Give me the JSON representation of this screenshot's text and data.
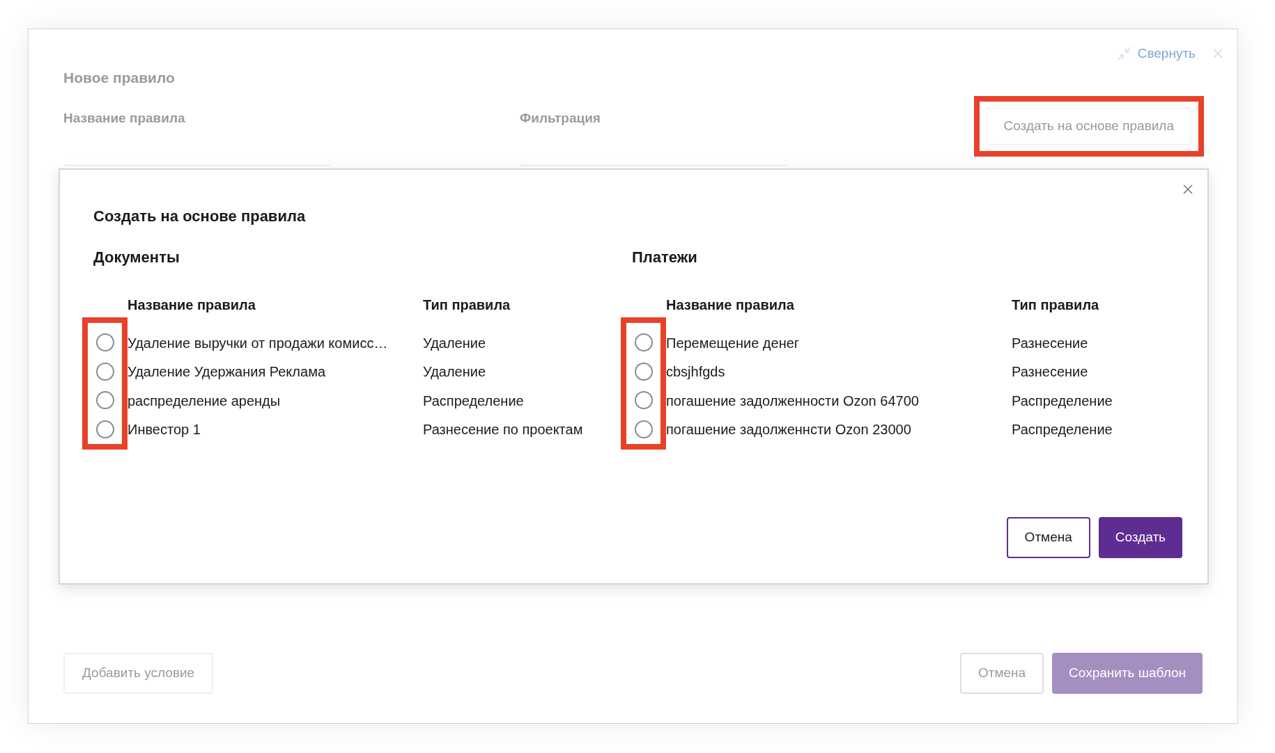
{
  "window": {
    "title": "Новое правило",
    "collapse_label": "Свернуть",
    "disabled": true
  },
  "fields": [
    {
      "label": "Название правила"
    },
    {
      "label": "Фильтрация"
    }
  ],
  "create_from_button": {
    "label": "Создать на основе правила",
    "highlighted": true
  },
  "footer": {
    "add_condition": "Добавить условие",
    "cancel": "Отмена",
    "save": "Сохранить шаблон"
  },
  "dialog": {
    "title": "Создать на основе правила",
    "sections": [
      {
        "title": "Документы",
        "highlighted": true,
        "columns": [
          "Название правила",
          "Тип правила"
        ],
        "rows": [
          {
            "name": "Удаление выручки от продажи комисс…",
            "type": "Удаление",
            "selected": false
          },
          {
            "name": "Удаление Удержания Реклама",
            "type": "Удаление",
            "selected": false
          },
          {
            "name": "распределение аренды",
            "type": "Распределение",
            "selected": false
          },
          {
            "name": "Инвестор 1",
            "type": "Разнесение по проектам",
            "selected": false
          }
        ]
      },
      {
        "title": "Платежи",
        "highlighted": true,
        "columns": [
          "Название правила",
          "Тип правила"
        ],
        "rows": [
          {
            "name": "Перемещение денег",
            "type": "Разнесение",
            "selected": false
          },
          {
            "name": "cbsjhfgds",
            "type": "Разнесение",
            "selected": false
          },
          {
            "name": "погашение задолженности Ozon 64700",
            "type": "Распределение",
            "selected": false
          },
          {
            "name": "погашение задолженнсти Ozon 23000",
            "type": "Распределение",
            "selected": false
          }
        ]
      }
    ],
    "buttons": [
      {
        "label": "Отмена",
        "kind": "secondary"
      },
      {
        "label": "Создать",
        "kind": "primary"
      }
    ]
  }
}
